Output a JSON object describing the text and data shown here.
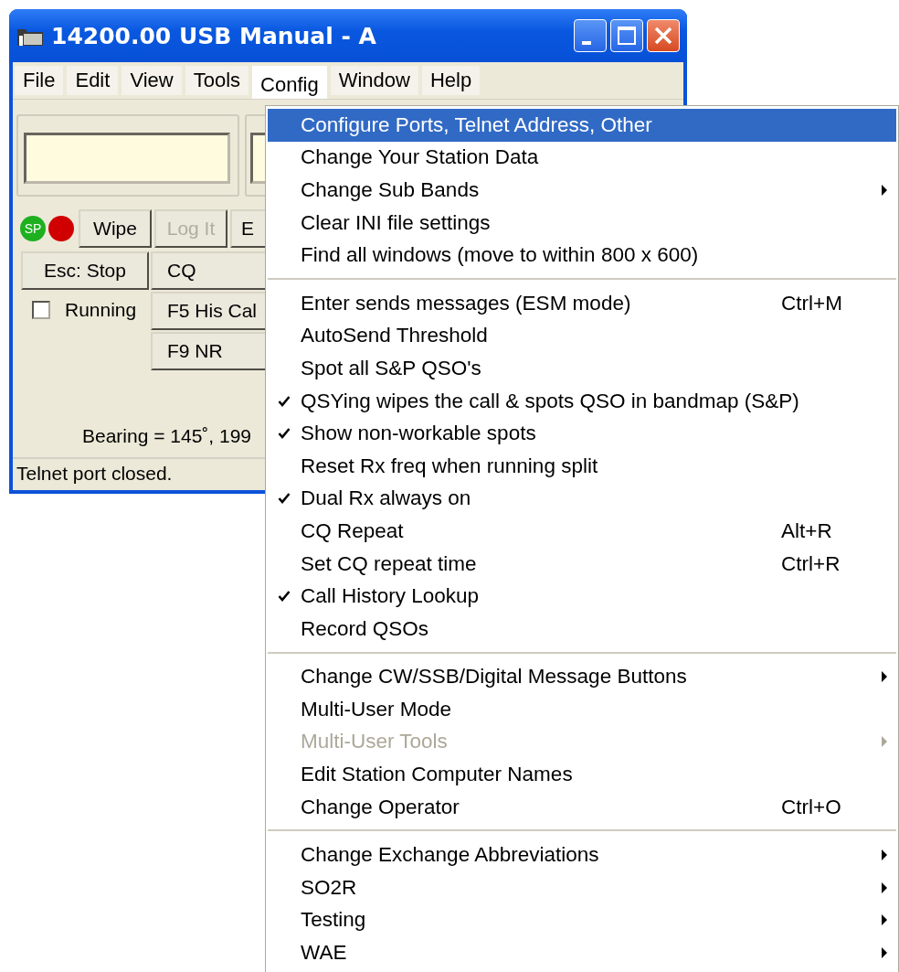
{
  "window": {
    "title": "14200.00 USB Manual - A"
  },
  "menu_bar": [
    {
      "label": "File",
      "selected": false
    },
    {
      "label": "Edit",
      "selected": false
    },
    {
      "label": "View",
      "selected": false
    },
    {
      "label": "Tools",
      "selected": false
    },
    {
      "label": "Config",
      "selected": true
    },
    {
      "label": "Window",
      "selected": false
    },
    {
      "label": "Help",
      "selected": false
    }
  ],
  "indicators": [
    {
      "label": "SP",
      "color": "#1fb01f"
    },
    {
      "color": "#d00000"
    }
  ],
  "action_buttons": [
    {
      "label": "Wipe",
      "disabled": false
    },
    {
      "label": "Log It",
      "disabled": true
    },
    {
      "label": "E",
      "disabled": false
    }
  ],
  "function_keys": [
    {
      "left": "Esc: Stop",
      "right": "CQ"
    },
    {
      "right": "F5 His Cal"
    },
    {
      "right": "F9 NR"
    }
  ],
  "running": {
    "label": "Running",
    "checked": false
  },
  "bearing": "Bearing = 145˚, 199",
  "status_bar": "Telnet port closed.",
  "config_menu": {
    "sections": [
      {
        "items": [
          {
            "label": "Configure Ports, Telnet Address, Other",
            "selected": true,
            "checked": false,
            "disabled": false,
            "submenu": false
          },
          {
            "label": "Change Your Station Data",
            "selected": false,
            "checked": false,
            "disabled": false,
            "submenu": false
          },
          {
            "label": "Change Sub Bands",
            "selected": false,
            "checked": false,
            "disabled": false,
            "submenu": true
          },
          {
            "label": "Clear INI file settings",
            "selected": false,
            "checked": false,
            "disabled": false,
            "submenu": false
          },
          {
            "label": "Find all windows (move to within 800 x 600)",
            "selected": false,
            "checked": false,
            "disabled": false,
            "submenu": false
          }
        ]
      },
      {
        "items": [
          {
            "label": "Enter sends messages (ESM mode)",
            "shortcut": "Ctrl+M",
            "selected": false,
            "checked": false,
            "disabled": false,
            "submenu": false
          },
          {
            "label": "AutoSend Threshold",
            "selected": false,
            "checked": false,
            "disabled": false,
            "submenu": false
          },
          {
            "label": "Spot all S&P QSO's",
            "selected": false,
            "checked": false,
            "disabled": false,
            "submenu": false
          },
          {
            "label": "QSYing wipes the call & spots QSO in bandmap (S&P)",
            "selected": false,
            "checked": true,
            "disabled": false,
            "submenu": false
          },
          {
            "label": "Show non-workable spots",
            "selected": false,
            "checked": true,
            "disabled": false,
            "submenu": false
          },
          {
            "label": "Reset Rx freq when running split",
            "selected": false,
            "checked": false,
            "disabled": false,
            "submenu": false
          },
          {
            "label": "Dual Rx always on",
            "selected": false,
            "checked": true,
            "disabled": false,
            "submenu": false
          },
          {
            "label": "CQ Repeat",
            "shortcut": "Alt+R",
            "selected": false,
            "checked": false,
            "disabled": false,
            "submenu": false
          },
          {
            "label": "Set CQ repeat time",
            "shortcut": "Ctrl+R",
            "selected": false,
            "checked": false,
            "disabled": false,
            "submenu": false
          },
          {
            "label": "Call History Lookup",
            "selected": false,
            "checked": true,
            "disabled": false,
            "submenu": false
          },
          {
            "label": "Record QSOs",
            "selected": false,
            "checked": false,
            "disabled": false,
            "submenu": false
          }
        ]
      },
      {
        "items": [
          {
            "label": "Change CW/SSB/Digital Message Buttons",
            "selected": false,
            "checked": false,
            "disabled": false,
            "submenu": true
          },
          {
            "label": "Multi-User Mode",
            "selected": false,
            "checked": false,
            "disabled": false,
            "submenu": false
          },
          {
            "label": "Multi-User Tools",
            "selected": false,
            "checked": false,
            "disabled": true,
            "submenu": true
          },
          {
            "label": "Edit Station Computer Names",
            "selected": false,
            "checked": false,
            "disabled": false,
            "submenu": false
          },
          {
            "label": "Change Operator",
            "shortcut": "Ctrl+O",
            "selected": false,
            "checked": false,
            "disabled": false,
            "submenu": false
          }
        ]
      },
      {
        "items": [
          {
            "label": "Change Exchange Abbreviations",
            "selected": false,
            "checked": false,
            "disabled": false,
            "submenu": true
          },
          {
            "label": "SO2R",
            "selected": false,
            "checked": false,
            "disabled": false,
            "submenu": true
          },
          {
            "label": "Testing",
            "selected": false,
            "checked": false,
            "disabled": false,
            "submenu": true
          },
          {
            "label": "WAE",
            "selected": false,
            "checked": false,
            "disabled": false,
            "submenu": true
          }
        ]
      }
    ]
  }
}
